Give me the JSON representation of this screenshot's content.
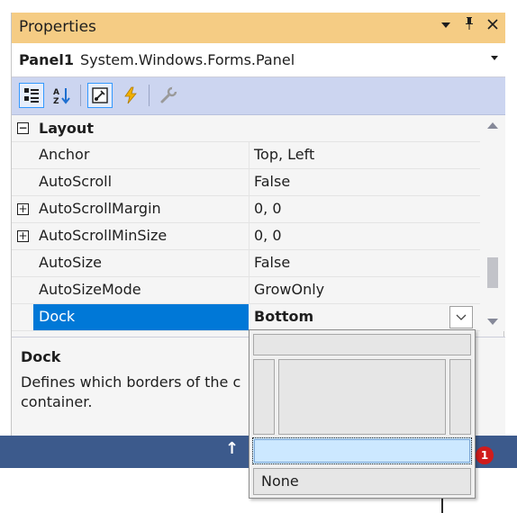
{
  "window": {
    "title": "Properties",
    "controls": {
      "dropdown": "▾",
      "pin": "ᵖ",
      "close": "✕"
    }
  },
  "object_selector": {
    "name": "Panel1",
    "type": "System.Windows.Forms.Panel"
  },
  "toolbar": {
    "icons": [
      "categorized-icon",
      "alphabetical-icon",
      "properties-icon",
      "events-icon",
      "property-pages-icon"
    ]
  },
  "grid": {
    "category": {
      "expander": "−",
      "label": "Layout"
    },
    "rows": [
      {
        "name": "Anchor",
        "value": "Top, Left",
        "expandable": false
      },
      {
        "name": "AutoScroll",
        "value": "False",
        "expandable": false
      },
      {
        "name": "AutoScrollMargin",
        "value": "0, 0",
        "expandable": true,
        "expander": "+"
      },
      {
        "name": "AutoScrollMinSize",
        "value": "0, 0",
        "expandable": true,
        "expander": "+"
      },
      {
        "name": "AutoSize",
        "value": "False",
        "expandable": false
      },
      {
        "name": "AutoSizeMode",
        "value": "GrowOnly",
        "expandable": false
      }
    ],
    "selected": {
      "name": "Dock",
      "value": "Bottom"
    }
  },
  "description": {
    "title": "Dock",
    "text_line1": "Defines which borders of the c",
    "text_line2": "container."
  },
  "statusbar": {
    "arrow": "↑",
    "badge": "1"
  },
  "dock_popup": {
    "none_label": "None",
    "selected": "bottom"
  },
  "colors": {
    "title": "#f5cc84",
    "toolbar": "#ccd5f0",
    "selection": "#0078d7",
    "status": "#3c5a8c"
  }
}
